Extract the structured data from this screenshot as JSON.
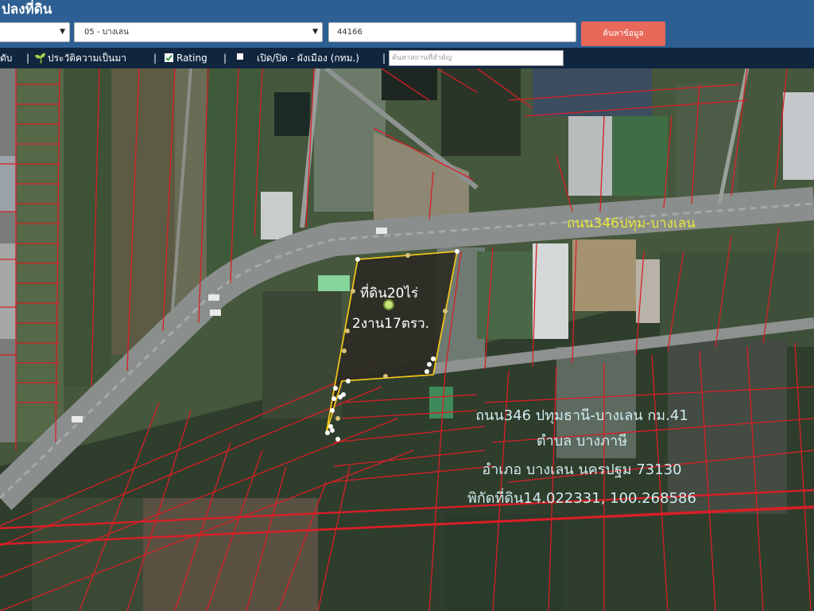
{
  "header": {
    "title": "ปลงที่ดิน",
    "province_select": "",
    "district_select": "05 - บางเลน",
    "deed_input": "44166",
    "search_button": "ค้นหาข้อมูล"
  },
  "toolbar": {
    "item1": "ดับ",
    "sep": "|",
    "history_label": "ประวัติความเป็นมา",
    "rating_label": "Rating",
    "cityplan_label": "เปิด/ปิด - ผังเมือง (กทม.)",
    "place_placeholder": "ค้นหาสถานที่สำคัญ"
  },
  "map": {
    "road_label": "ถนน346ปทุม-บางเลน",
    "parcel_line1": "ที่ดิน20ไร่",
    "parcel_line2": "2งาน17ตรว.",
    "address": [
      "ถนน346 ปทุมธานี-บางเลน กม.41",
      "ตำบล บางภาษี",
      "อำเภอ บางเลน นครปฐม 73130",
      "พิกัดที่ดิน14.022331, 100.268586"
    ],
    "colors": {
      "parcel_line": "#d81f26",
      "parcel_highlight": "#f0c419",
      "label_text": "#cfeef0",
      "road_label": "#e8e83c"
    }
  }
}
